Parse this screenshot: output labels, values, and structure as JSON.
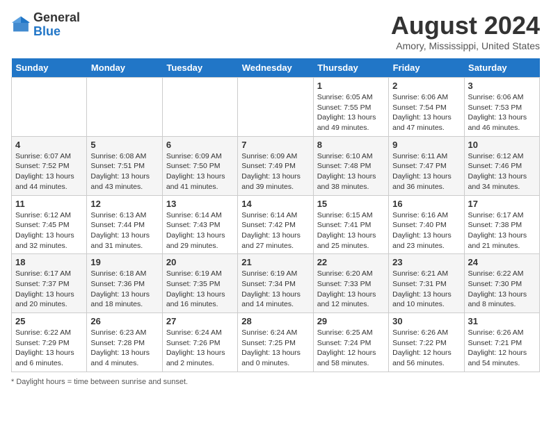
{
  "header": {
    "logo": {
      "general": "General",
      "blue": "Blue"
    },
    "month_title": "August 2024",
    "location": "Amory, Mississippi, United States"
  },
  "days_of_week": [
    "Sunday",
    "Monday",
    "Tuesday",
    "Wednesday",
    "Thursday",
    "Friday",
    "Saturday"
  ],
  "footer": {
    "daylight_note": "Daylight hours"
  },
  "weeks": [
    [
      {
        "day": "",
        "info": ""
      },
      {
        "day": "",
        "info": ""
      },
      {
        "day": "",
        "info": ""
      },
      {
        "day": "",
        "info": ""
      },
      {
        "day": "1",
        "info": "Sunrise: 6:05 AM\nSunset: 7:55 PM\nDaylight: 13 hours and 49 minutes."
      },
      {
        "day": "2",
        "info": "Sunrise: 6:06 AM\nSunset: 7:54 PM\nDaylight: 13 hours and 47 minutes."
      },
      {
        "day": "3",
        "info": "Sunrise: 6:06 AM\nSunset: 7:53 PM\nDaylight: 13 hours and 46 minutes."
      }
    ],
    [
      {
        "day": "4",
        "info": "Sunrise: 6:07 AM\nSunset: 7:52 PM\nDaylight: 13 hours and 44 minutes."
      },
      {
        "day": "5",
        "info": "Sunrise: 6:08 AM\nSunset: 7:51 PM\nDaylight: 13 hours and 43 minutes."
      },
      {
        "day": "6",
        "info": "Sunrise: 6:09 AM\nSunset: 7:50 PM\nDaylight: 13 hours and 41 minutes."
      },
      {
        "day": "7",
        "info": "Sunrise: 6:09 AM\nSunset: 7:49 PM\nDaylight: 13 hours and 39 minutes."
      },
      {
        "day": "8",
        "info": "Sunrise: 6:10 AM\nSunset: 7:48 PM\nDaylight: 13 hours and 38 minutes."
      },
      {
        "day": "9",
        "info": "Sunrise: 6:11 AM\nSunset: 7:47 PM\nDaylight: 13 hours and 36 minutes."
      },
      {
        "day": "10",
        "info": "Sunrise: 6:12 AM\nSunset: 7:46 PM\nDaylight: 13 hours and 34 minutes."
      }
    ],
    [
      {
        "day": "11",
        "info": "Sunrise: 6:12 AM\nSunset: 7:45 PM\nDaylight: 13 hours and 32 minutes."
      },
      {
        "day": "12",
        "info": "Sunrise: 6:13 AM\nSunset: 7:44 PM\nDaylight: 13 hours and 31 minutes."
      },
      {
        "day": "13",
        "info": "Sunrise: 6:14 AM\nSunset: 7:43 PM\nDaylight: 13 hours and 29 minutes."
      },
      {
        "day": "14",
        "info": "Sunrise: 6:14 AM\nSunset: 7:42 PM\nDaylight: 13 hours and 27 minutes."
      },
      {
        "day": "15",
        "info": "Sunrise: 6:15 AM\nSunset: 7:41 PM\nDaylight: 13 hours and 25 minutes."
      },
      {
        "day": "16",
        "info": "Sunrise: 6:16 AM\nSunset: 7:40 PM\nDaylight: 13 hours and 23 minutes."
      },
      {
        "day": "17",
        "info": "Sunrise: 6:17 AM\nSunset: 7:38 PM\nDaylight: 13 hours and 21 minutes."
      }
    ],
    [
      {
        "day": "18",
        "info": "Sunrise: 6:17 AM\nSunset: 7:37 PM\nDaylight: 13 hours and 20 minutes."
      },
      {
        "day": "19",
        "info": "Sunrise: 6:18 AM\nSunset: 7:36 PM\nDaylight: 13 hours and 18 minutes."
      },
      {
        "day": "20",
        "info": "Sunrise: 6:19 AM\nSunset: 7:35 PM\nDaylight: 13 hours and 16 minutes."
      },
      {
        "day": "21",
        "info": "Sunrise: 6:19 AM\nSunset: 7:34 PM\nDaylight: 13 hours and 14 minutes."
      },
      {
        "day": "22",
        "info": "Sunrise: 6:20 AM\nSunset: 7:33 PM\nDaylight: 13 hours and 12 minutes."
      },
      {
        "day": "23",
        "info": "Sunrise: 6:21 AM\nSunset: 7:31 PM\nDaylight: 13 hours and 10 minutes."
      },
      {
        "day": "24",
        "info": "Sunrise: 6:22 AM\nSunset: 7:30 PM\nDaylight: 13 hours and 8 minutes."
      }
    ],
    [
      {
        "day": "25",
        "info": "Sunrise: 6:22 AM\nSunset: 7:29 PM\nDaylight: 13 hours and 6 minutes."
      },
      {
        "day": "26",
        "info": "Sunrise: 6:23 AM\nSunset: 7:28 PM\nDaylight: 13 hours and 4 minutes."
      },
      {
        "day": "27",
        "info": "Sunrise: 6:24 AM\nSunset: 7:26 PM\nDaylight: 13 hours and 2 minutes."
      },
      {
        "day": "28",
        "info": "Sunrise: 6:24 AM\nSunset: 7:25 PM\nDaylight: 13 hours and 0 minutes."
      },
      {
        "day": "29",
        "info": "Sunrise: 6:25 AM\nSunset: 7:24 PM\nDaylight: 12 hours and 58 minutes."
      },
      {
        "day": "30",
        "info": "Sunrise: 6:26 AM\nSunset: 7:22 PM\nDaylight: 12 hours and 56 minutes."
      },
      {
        "day": "31",
        "info": "Sunrise: 6:26 AM\nSunset: 7:21 PM\nDaylight: 12 hours and 54 minutes."
      }
    ]
  ]
}
